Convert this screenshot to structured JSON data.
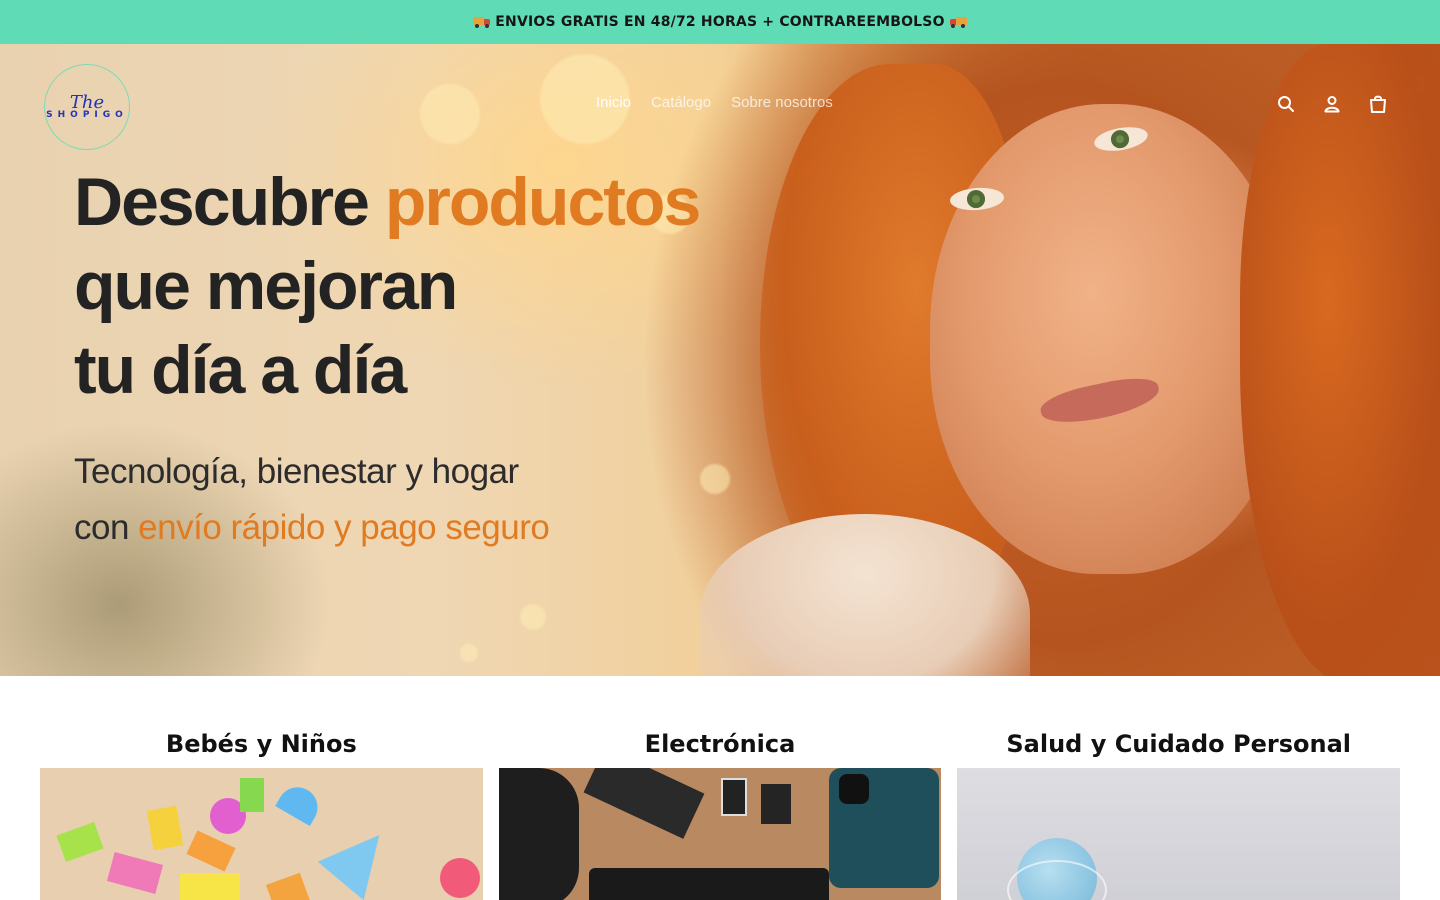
{
  "announcement": {
    "text": "ENVIOS GRATIS EN 48/72 HORAS + CONTRAREEMBOLSO"
  },
  "logo": {
    "script": "The",
    "word": "SHOPIGO"
  },
  "nav": {
    "items": [
      "Inicio",
      "Catálogo",
      "Sobre nosotros"
    ]
  },
  "header_icons": [
    "search-icon",
    "account-icon",
    "cart-icon"
  ],
  "hero": {
    "headline_line1_a": "Descubre",
    "headline_line1_b": "productos",
    "headline_line2": "que mejoran",
    "headline_line3": "tu día a día",
    "sub_line1": "Tecnología, bienestar y hogar",
    "sub_line2_a": "con",
    "sub_line2_b": "envío rápido y pago seguro"
  },
  "collections": [
    {
      "title": "Bebés y Niños"
    },
    {
      "title": "Electrónica"
    },
    {
      "title": "Salud y Cuidado Personal"
    }
  ],
  "colors": {
    "announcement_bg": "#5fdcb6",
    "accent": "#e07b22",
    "logo": "#2234b8"
  }
}
